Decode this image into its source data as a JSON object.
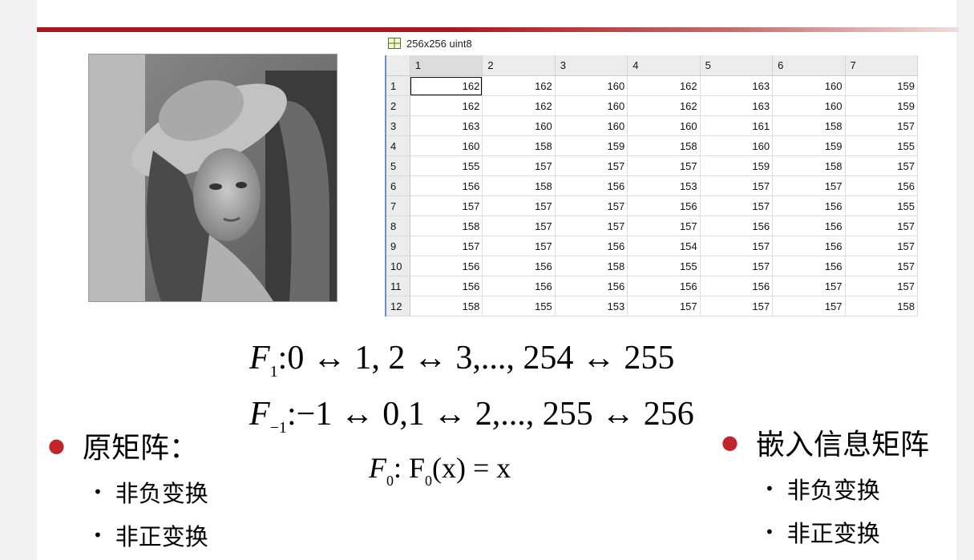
{
  "variable": {
    "title": "256x256 uint8",
    "columns": [
      "1",
      "2",
      "3",
      "4",
      "5",
      "6",
      "7"
    ],
    "rows": [
      {
        "label": "1",
        "values": [
          "162",
          "162",
          "160",
          "162",
          "163",
          "160",
          "159"
        ]
      },
      {
        "label": "2",
        "values": [
          "162",
          "162",
          "160",
          "162",
          "163",
          "160",
          "159"
        ]
      },
      {
        "label": "3",
        "values": [
          "163",
          "160",
          "160",
          "160",
          "161",
          "158",
          "157"
        ]
      },
      {
        "label": "4",
        "values": [
          "160",
          "158",
          "159",
          "158",
          "160",
          "159",
          "155"
        ]
      },
      {
        "label": "5",
        "values": [
          "155",
          "157",
          "157",
          "157",
          "159",
          "158",
          "157"
        ]
      },
      {
        "label": "6",
        "values": [
          "156",
          "158",
          "156",
          "153",
          "157",
          "157",
          "156"
        ]
      },
      {
        "label": "7",
        "values": [
          "157",
          "157",
          "157",
          "156",
          "157",
          "156",
          "155"
        ]
      },
      {
        "label": "8",
        "values": [
          "158",
          "157",
          "157",
          "157",
          "156",
          "156",
          "157"
        ]
      },
      {
        "label": "9",
        "values": [
          "157",
          "157",
          "156",
          "154",
          "157",
          "156",
          "157"
        ]
      },
      {
        "label": "10",
        "values": [
          "156",
          "156",
          "158",
          "155",
          "157",
          "156",
          "157"
        ]
      },
      {
        "label": "11",
        "values": [
          "156",
          "156",
          "156",
          "156",
          "156",
          "157",
          "157"
        ]
      },
      {
        "label": "12",
        "values": [
          "158",
          "155",
          "153",
          "157",
          "157",
          "157",
          "158"
        ]
      }
    ]
  },
  "formulas": {
    "f1": {
      "symbol": "F",
      "sub": "1",
      "body": ":0 ↔ 1, 2 ↔ 3,..., 254 ↔ 255"
    },
    "f2": {
      "symbol": "F",
      "sub": "−1",
      "body": ":−1 ↔ 0,1 ↔ 2,..., 255 ↔ 256"
    },
    "f3": {
      "symbol": "F",
      "sub": "0",
      "body": ": F",
      "sub2": "0",
      "tail": "(x) = x"
    }
  },
  "left_list": {
    "heading": "原矩阵：",
    "items": [
      "非负变换",
      "非正变换"
    ]
  },
  "right_list": {
    "heading": "嵌入信息矩阵",
    "items": [
      "非负变换",
      "非正变换"
    ]
  },
  "colors": {
    "accent": "#a8191e",
    "bullet": "#c0262c"
  }
}
